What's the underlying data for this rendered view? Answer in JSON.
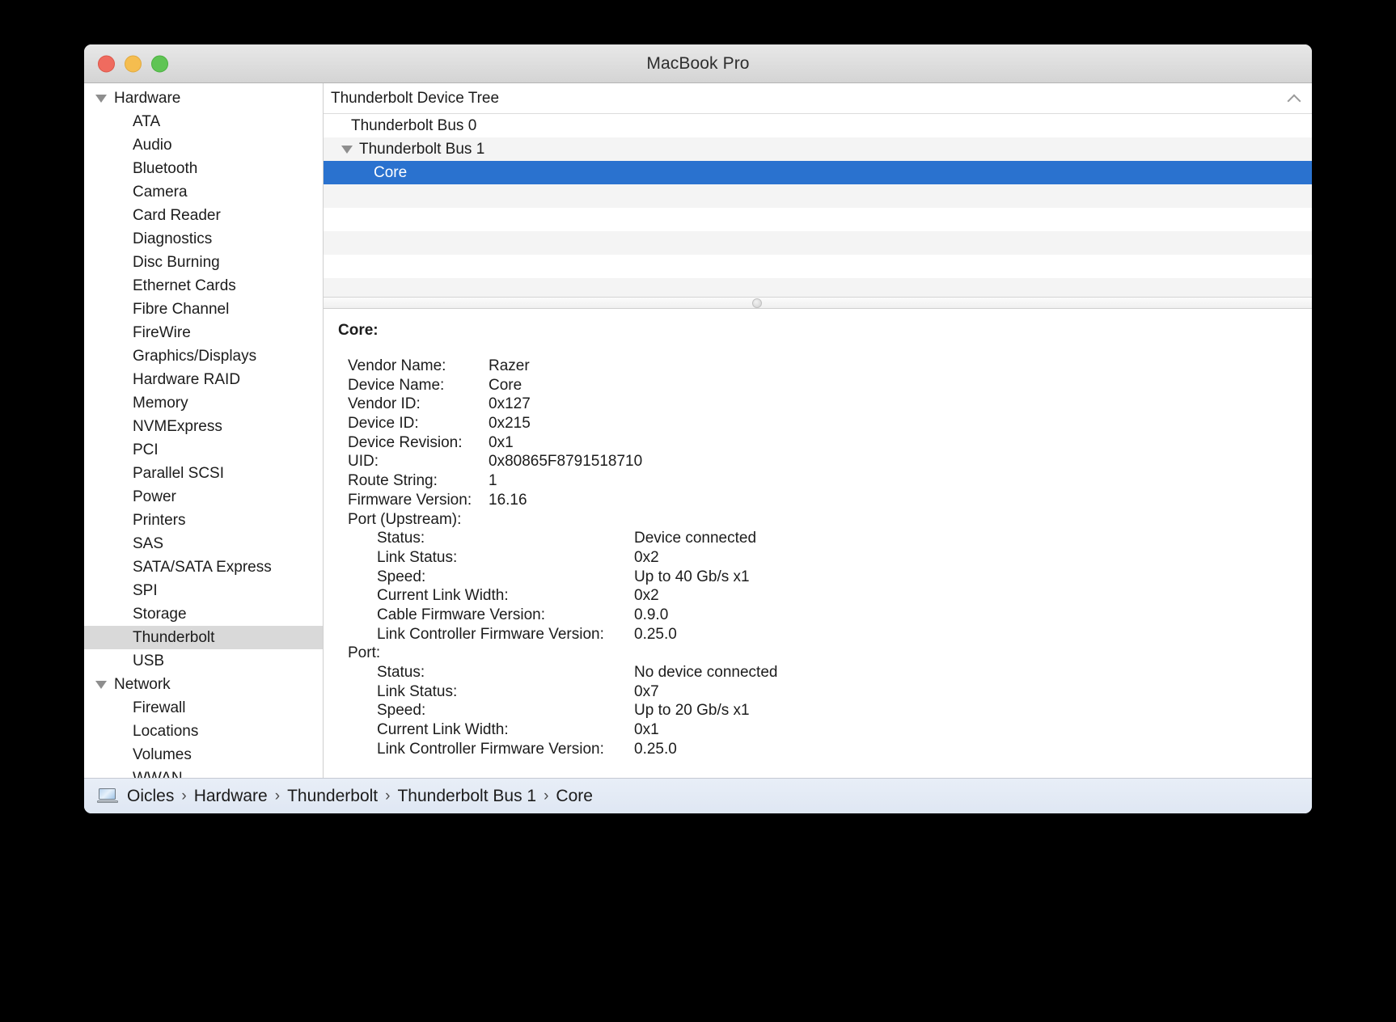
{
  "window": {
    "title": "MacBook Pro",
    "traffic_lights": [
      "close",
      "minimize",
      "maximize"
    ]
  },
  "sidebar": {
    "items": [
      {
        "label": "Hardware",
        "type": "group",
        "expanded": true,
        "selected": false
      },
      {
        "label": "ATA",
        "type": "child",
        "selected": false
      },
      {
        "label": "Audio",
        "type": "child",
        "selected": false
      },
      {
        "label": "Bluetooth",
        "type": "child",
        "selected": false
      },
      {
        "label": "Camera",
        "type": "child",
        "selected": false
      },
      {
        "label": "Card Reader",
        "type": "child",
        "selected": false
      },
      {
        "label": "Diagnostics",
        "type": "child",
        "selected": false
      },
      {
        "label": "Disc Burning",
        "type": "child",
        "selected": false
      },
      {
        "label": "Ethernet Cards",
        "type": "child",
        "selected": false
      },
      {
        "label": "Fibre Channel",
        "type": "child",
        "selected": false
      },
      {
        "label": "FireWire",
        "type": "child",
        "selected": false
      },
      {
        "label": "Graphics/Displays",
        "type": "child",
        "selected": false
      },
      {
        "label": "Hardware RAID",
        "type": "child",
        "selected": false
      },
      {
        "label": "Memory",
        "type": "child",
        "selected": false
      },
      {
        "label": "NVMExpress",
        "type": "child",
        "selected": false
      },
      {
        "label": "PCI",
        "type": "child",
        "selected": false
      },
      {
        "label": "Parallel SCSI",
        "type": "child",
        "selected": false
      },
      {
        "label": "Power",
        "type": "child",
        "selected": false
      },
      {
        "label": "Printers",
        "type": "child",
        "selected": false
      },
      {
        "label": "SAS",
        "type": "child",
        "selected": false
      },
      {
        "label": "SATA/SATA Express",
        "type": "child",
        "selected": false
      },
      {
        "label": "SPI",
        "type": "child",
        "selected": false
      },
      {
        "label": "Storage",
        "type": "child",
        "selected": false
      },
      {
        "label": "Thunderbolt",
        "type": "child",
        "selected": true
      },
      {
        "label": "USB",
        "type": "child",
        "selected": false
      },
      {
        "label": "Network",
        "type": "group",
        "expanded": true,
        "selected": false
      },
      {
        "label": "Firewall",
        "type": "child",
        "selected": false
      },
      {
        "label": "Locations",
        "type": "child",
        "selected": false
      },
      {
        "label": "Volumes",
        "type": "child",
        "selected": false
      },
      {
        "label": "WWAN",
        "type": "child",
        "selected": false
      }
    ]
  },
  "device_tree": {
    "header": "Thunderbolt Device Tree",
    "collapse_icon": "chevron-up-icon",
    "rows": [
      {
        "label": "Thunderbolt Bus 0",
        "indent": 1,
        "expander": false,
        "selected": false,
        "stripe": false
      },
      {
        "label": "Thunderbolt Bus 1",
        "indent": 0,
        "expander": true,
        "selected": false,
        "stripe": true
      },
      {
        "label": "Core",
        "indent": 2,
        "expander": false,
        "selected": true,
        "stripe": false
      }
    ],
    "empty_rows": 5,
    "selection_color": "#2a72cf",
    "stripe_color": "#f4f4f4"
  },
  "detail": {
    "title": "Core:",
    "rows": [
      {
        "level": 0,
        "key": "Vendor Name:",
        "value": "Razer"
      },
      {
        "level": 0,
        "key": "Device Name:",
        "value": "Core"
      },
      {
        "level": 0,
        "key": "Vendor ID:",
        "value": "0x127"
      },
      {
        "level": 0,
        "key": "Device ID:",
        "value": "0x215"
      },
      {
        "level": 0,
        "key": "Device Revision:",
        "value": "0x1"
      },
      {
        "level": 0,
        "key": "UID:",
        "value": "0x80865F8791518710"
      },
      {
        "level": 0,
        "key": "Route String:",
        "value": "1"
      },
      {
        "level": 0,
        "key": "Firmware Version:",
        "value": "16.16"
      },
      {
        "level": 0,
        "key": "Port (Upstream):",
        "value": "",
        "section": true
      },
      {
        "level": 1,
        "key": "Status:",
        "value": "Device connected"
      },
      {
        "level": 1,
        "key": "Link Status:",
        "value": "0x2"
      },
      {
        "level": 1,
        "key": "Speed:",
        "value": "Up to 40 Gb/s x1"
      },
      {
        "level": 1,
        "key": "Current Link Width:",
        "value": "0x2"
      },
      {
        "level": 1,
        "key": "Cable Firmware Version:",
        "value": "0.9.0"
      },
      {
        "level": 1,
        "key": "Link Controller Firmware Version:",
        "value": "0.25.0"
      },
      {
        "level": 0,
        "key": "Port:",
        "value": "",
        "section": true
      },
      {
        "level": 1,
        "key": "Status:",
        "value": "No device connected"
      },
      {
        "level": 1,
        "key": "Link Status:",
        "value": "0x7"
      },
      {
        "level": 1,
        "key": "Speed:",
        "value": "Up to 20 Gb/s x1"
      },
      {
        "level": 1,
        "key": "Current Link Width:",
        "value": "0x1"
      },
      {
        "level": 1,
        "key": "Link Controller Firmware Version:",
        "value": "0.25.0"
      }
    ]
  },
  "footer": {
    "icon": "macbook-icon",
    "separator": "›",
    "crumbs": [
      "Oicles",
      "Hardware",
      "Thunderbolt",
      "Thunderbolt Bus 1",
      "Core"
    ]
  }
}
